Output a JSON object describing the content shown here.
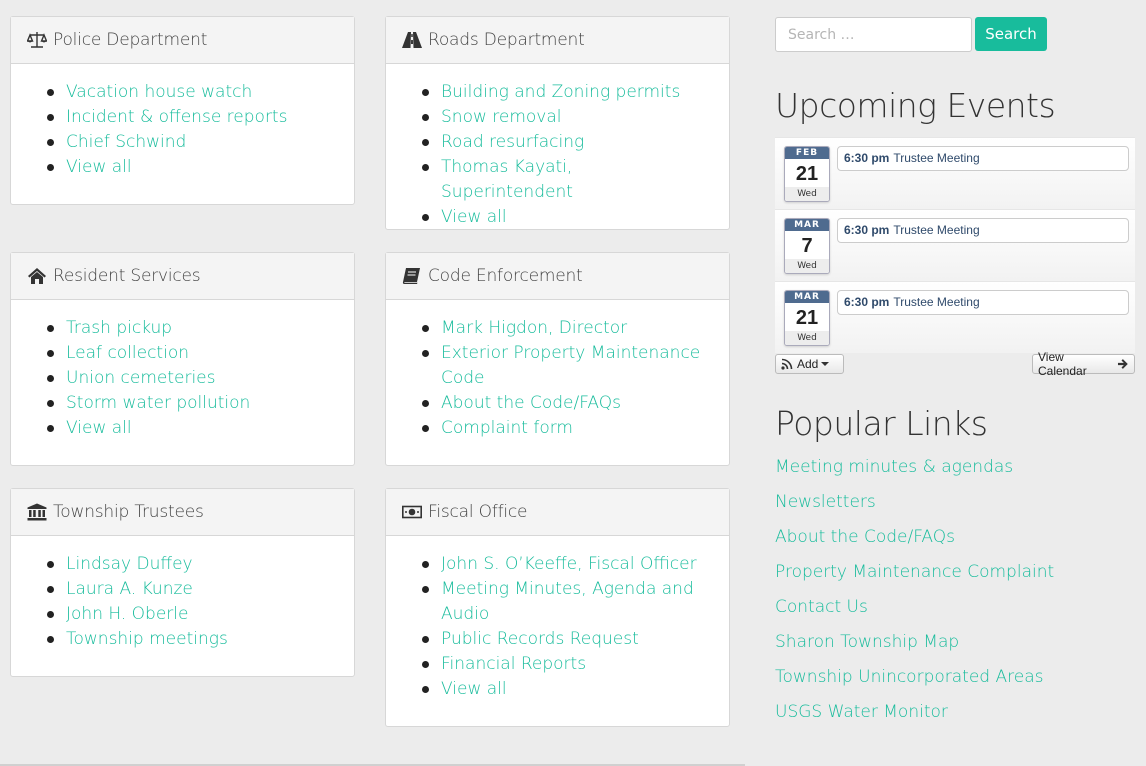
{
  "panels": [
    {
      "title": "Police Department",
      "icon": "scale-icon",
      "items": [
        "Vacation house watch",
        "Incident & offense reports",
        "Chief Schwind",
        "View all"
      ]
    },
    {
      "title": "Roads Department",
      "icon": "road-icon",
      "items": [
        "Building and Zoning permits",
        "Snow removal",
        "Road resurfacing",
        "Thomas Kayati, Superintendent",
        "View all"
      ]
    },
    {
      "title": "Resident Services",
      "icon": "home-icon",
      "items": [
        "Trash pickup",
        "Leaf collection",
        "Union cemeteries",
        "Storm water pollution",
        "View all"
      ]
    },
    {
      "title": "Code Enforcement",
      "icon": "book-icon",
      "items": [
        "Mark Higdon, Director",
        "Exterior Property Maintenance Code",
        "About the Code/FAQs",
        "Complaint form"
      ]
    },
    {
      "title": "Township Trustees",
      "icon": "institution-icon",
      "items": [
        "Lindsay Duffey",
        "Laura A. Kunze",
        "John H. Oberle",
        "Township meetings"
      ]
    },
    {
      "title": "Fiscal Office",
      "icon": "money-icon",
      "items": [
        "John S. O’Keeffe, Fiscal Officer",
        "Meeting Minutes, Agenda and Audio",
        "Public Records Request",
        "Financial Reports",
        "View all"
      ]
    }
  ],
  "search": {
    "placeholder": "Search …",
    "button_label": "Search"
  },
  "events": {
    "title": "Upcoming Events",
    "items": [
      {
        "month": "FEB",
        "day": "21",
        "dow": "Wed",
        "time": "6:30 pm",
        "title": "Trustee Meeting"
      },
      {
        "month": "MAR",
        "day": "7",
        "dow": "Wed",
        "time": "6:30 pm",
        "title": "Trustee Meeting"
      },
      {
        "month": "MAR",
        "day": "21",
        "dow": "Wed",
        "time": "6:30 pm",
        "title": "Trustee Meeting"
      }
    ],
    "add_label": "Add",
    "view_calendar_label": "View Calendar"
  },
  "popular_links": {
    "title": "Popular Links",
    "items": [
      "Meeting minutes & agendas",
      "Newsletters",
      "About the Code/FAQs",
      "Property Maintenance Complaint",
      "Contact Us",
      "Sharon Township Map",
      "Township Unincorporated Areas",
      "USGS Water Monitor"
    ]
  },
  "colors": {
    "accent": "#18bc9c",
    "calendar_header": "#4f6b8f"
  }
}
